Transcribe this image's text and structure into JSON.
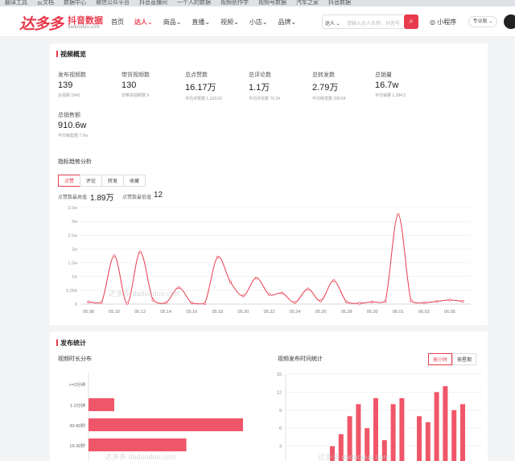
{
  "bookmarks": [
    "翻译工具",
    "云文档",
    "数据中心",
    "微信公众平台",
    "抖音直播间",
    "一个人的数据",
    "视频创作学",
    "视频号数据",
    "汽车之家",
    "抖音数据"
  ],
  "header": {
    "logo": "达多多",
    "logo_sub": "抖音数据",
    "logo_url": "daduoduo.com",
    "nav": [
      {
        "label": "首页",
        "active": false
      },
      {
        "label": "达人⌄",
        "active": true
      },
      {
        "label": "商品⌄",
        "active": false
      },
      {
        "label": "直播⌄",
        "active": false
      },
      {
        "label": "视频⌄",
        "active": false
      },
      {
        "label": "小店⌄",
        "active": false
      },
      {
        "label": "品牌⌄",
        "active": false
      }
    ],
    "search_select": "达人 ⌄",
    "search_placeholder": "请输入达人名称、抖音号",
    "mini_program": "小程序",
    "pro": "专业版 ⌄"
  },
  "overview": {
    "title": "视频概览",
    "metrics": [
      {
        "label": "发布视频数",
        "value": "139",
        "sub": "总视频 1843"
      },
      {
        "label": "带货视频数",
        "value": "130",
        "sub": "非带货视频数 9"
      },
      {
        "label": "总点赞数",
        "value": "16.17万",
        "sub": "平均点赞数 1,163.63"
      },
      {
        "label": "总评论数",
        "value": "1.1万",
        "sub": "平均评论数 79.24"
      },
      {
        "label": "总转发数",
        "value": "2.79万",
        "sub": "平均转发数 200.64"
      },
      {
        "label": "总销量",
        "value": "16.7w",
        "sub": "平均销量 1,284.5"
      },
      {
        "label": "总销售额",
        "value": "910.6w",
        "sub": "平均销售额 7.0w"
      }
    ],
    "trend_title": "指标趋势分析",
    "tabs": [
      "点赞",
      "评论",
      "转发",
      "收藏"
    ],
    "peak_label": "点赞数最高值",
    "peak_value": "1.89万",
    "low_label": "点赞数最低值",
    "low_value": "12",
    "watermark": "达多多 daduoduo.com"
  },
  "chart_data": [
    {
      "type": "line",
      "x": [
        "05.08",
        "05.09",
        "05.10",
        "05.11",
        "05.12",
        "05.13",
        "05.14",
        "05.15",
        "05.16",
        "05.17",
        "05.18",
        "05.19",
        "05.20",
        "05.21",
        "05.22",
        "05.23",
        "05.24",
        "05.25",
        "05.26",
        "05.27",
        "05.28",
        "05.29",
        "05.30",
        "05.31",
        "06.01",
        "06.02",
        "06.03",
        "06.04",
        "06.05",
        "06.06"
      ],
      "x_ticks": [
        "05.08",
        "05.10",
        "05.12",
        "05.14",
        "05.16",
        "05.18",
        "05.20",
        "05.22",
        "05.24",
        "05.26",
        "05.28",
        "05.30",
        "06.01",
        "06.03",
        "06.05"
      ],
      "values": [
        800,
        600,
        17500,
        300,
        18900,
        1500,
        500,
        6000,
        400,
        200,
        17000,
        8000,
        3000,
        9500,
        3500,
        4000,
        600,
        5500,
        1200,
        8500,
        800,
        300,
        800,
        1000,
        32500,
        1200,
        500,
        1000,
        1500,
        1000
      ],
      "yticks": [
        "0",
        "5,000",
        "1w",
        "1.5w",
        "2w",
        "2.5w",
        "3w",
        "3.5w"
      ],
      "ylim": [
        0,
        35000
      ],
      "color": "#e83a4d"
    },
    {
      "type": "bar",
      "orientation": "horizontal",
      "categories": [
        ">=2分钟",
        "1-2分钟",
        "30-60秒",
        "15-30秒"
      ],
      "values": [
        0,
        10,
        60,
        38
      ],
      "color": "#f05669"
    },
    {
      "type": "bar",
      "yticks": [
        "3",
        "6",
        "9",
        "12",
        "15"
      ],
      "ylim": [
        0,
        15
      ],
      "values": [
        3,
        5,
        8,
        10,
        6,
        11,
        4,
        10,
        11,
        0,
        8,
        7,
        12,
        13,
        9,
        10
      ],
      "color": "#f05669"
    }
  ],
  "publish": {
    "title": "发布统计",
    "duration_title": "视频时长分布",
    "time_title": "视频发布时间统计",
    "btn_hour": "按小时",
    "btn_week": "按星期"
  }
}
